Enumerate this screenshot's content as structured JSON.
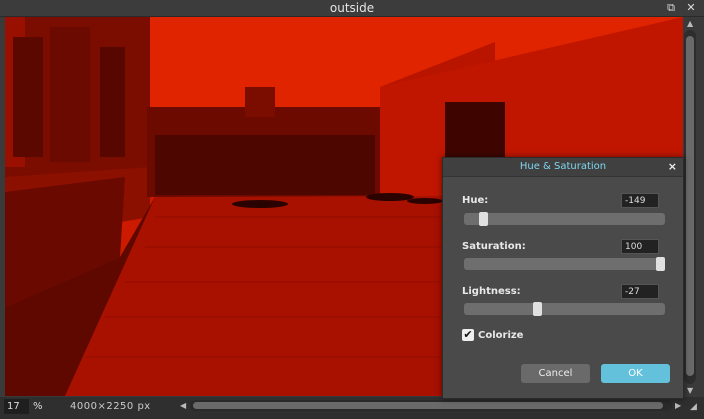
{
  "window": {
    "title": "outside"
  },
  "status": {
    "zoom_value": "17",
    "zoom_unit": "%",
    "dimensions": "4000×2250 px"
  },
  "dialog": {
    "title": "Hue & Saturation",
    "close": "×",
    "hue": {
      "label": "Hue:",
      "value": "-149",
      "fraction": 0.08
    },
    "saturation": {
      "label": "Saturation:",
      "value": "100",
      "fraction": 1.0
    },
    "lightness": {
      "label": "Lightness:",
      "value": "-27",
      "fraction": 0.36
    },
    "colorize": {
      "label": "Colorize",
      "checked": true
    },
    "cancel_label": "Cancel",
    "ok_label": "OK"
  },
  "colors": {
    "tint": "#c41400",
    "accent": "#64c1dc"
  }
}
